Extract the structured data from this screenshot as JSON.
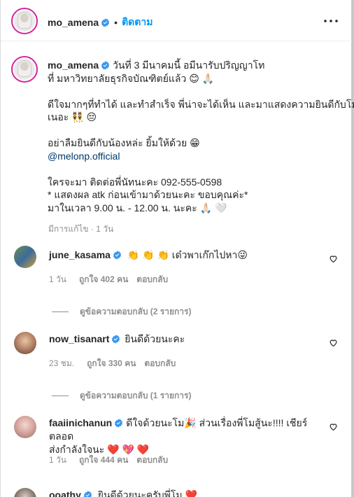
{
  "post_header": {
    "username": "mo_amena",
    "separator": "•",
    "follow_label": "ติดตาม"
  },
  "caption": {
    "username": "mo_amena",
    "line1": " วันที่ 3 มีนาคมนี้ อมีนารับปริญญาโท",
    "line2": "ที่ มหาวิทยาลัยธุรกิจบัณฑิตย์แล้ว 😊 🙏🏻",
    "line3": "ดีใจมากๆที่ทำได้ และทำสำเร็จ พี่น่าจะได้เห็น และมาแสดงความยินดีกับโม",
    "line4": "เนอะ 👯 😔",
    "line5": "อย่าลืมยินดีกับน้องหล่ะ ยิ้มให้ด้วย 😁",
    "mention": "@melonp.official",
    "line6": "ใครจะมา ติดต่อพี่นัทนะคะ 092-555-0598",
    "line7": "* แสดงผล atk ก่อนเข้ามาด้วยนะคะ ขอบคุณค่ะ*",
    "line8": "มาในเวลา 9.00 น. - 12.00 น. นะคะ 🙏🏻 🤍",
    "edited": "มีการแก้ไข · 1 วัน"
  },
  "comments": [
    {
      "username": "june_kasama",
      "text": "👏 👏 👏 เด๋วพาเก๊กไปหา😜",
      "time": "1 วัน",
      "likes": "ถูกใจ 402 คน",
      "reply": "ตอบกลับ",
      "view_replies": "ดูข้อความตอบกลับ (2 รายการ)"
    },
    {
      "username": "now_tisanart",
      "text": "ยินดีด้วยนะคะ",
      "time": "23 ชม.",
      "likes": "ถูกใจ 330 คน",
      "reply": "ตอบกลับ",
      "view_replies": "ดูข้อความตอบกลับ (1 รายการ)"
    },
    {
      "username": "faaiinichanun",
      "text_line1": "ดีใจด้วยนะโม🎉 ส่วนเรื่องพี่โมสู้นะ!!!! เชียร์ตลอด",
      "text_line2": "ส่งกำลังใจนะ ❤️ 💖 ❤️",
      "time": "1 วัน",
      "likes": "ถูกใจ 444 คน",
      "reply": "ตอบกลับ"
    },
    {
      "username": "ooathy",
      "text": "ยินดีด้วยนะครับพี่โม ❤️"
    }
  ],
  "colors": {
    "link_blue": "#0095f6",
    "mention_blue": "#00376b",
    "verified_blue": "#3897f0",
    "muted": "#8e8e8e"
  }
}
